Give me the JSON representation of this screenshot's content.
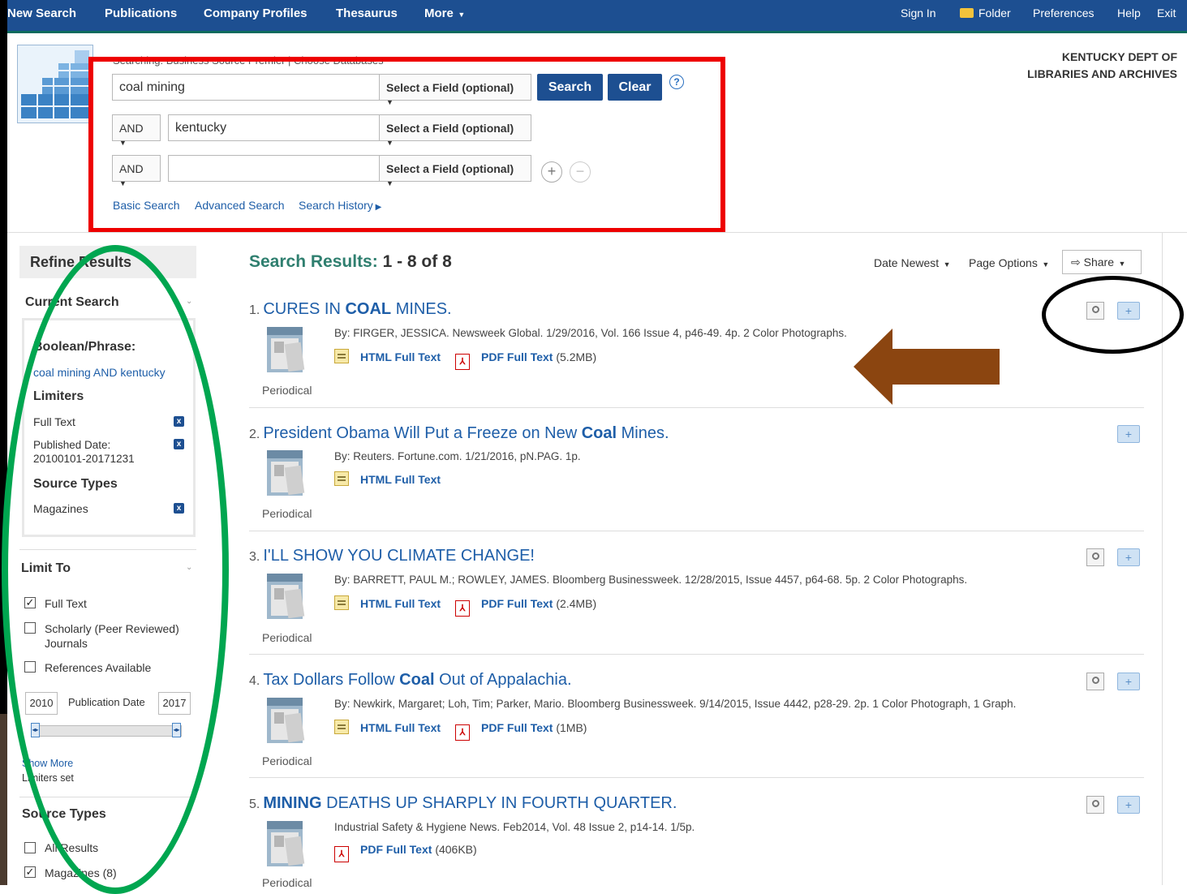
{
  "topnav": {
    "left": [
      "New Search",
      "Publications",
      "Company Profiles",
      "Thesaurus",
      "More"
    ],
    "right": {
      "sign_in": "Sign In",
      "folder": "Folder",
      "preferences": "Preferences",
      "help": "Help",
      "exit": "Exit"
    }
  },
  "header": {
    "org_line1": "KENTUCKY DEPT OF",
    "org_line2": "LIBRARIES AND ARCHIVES",
    "searching": "Searching: Business Source Premier | Choose Databases"
  },
  "search": {
    "row1_value": "coal mining",
    "row2_value": "kentucky",
    "row3_value": "",
    "field_label": "Select a Field (optional)",
    "bool": "AND",
    "search_btn": "Search",
    "clear_btn": "Clear",
    "help": "?",
    "links": {
      "basic": "Basic Search",
      "advanced": "Advanced Search",
      "history": "Search History"
    }
  },
  "sidebar": {
    "refine": "Refine Results",
    "current_search": "Current Search",
    "boolean_phrase": "Boolean/Phrase:",
    "query": "coal mining AND kentucky",
    "limiters": "Limiters",
    "full_text": "Full Text",
    "published_date_label": "Published Date:",
    "published_date_value": "20100101-20171231",
    "source_types": "Source Types",
    "magazines": "Magazines",
    "limit_to": "Limit To",
    "opt_full_text": "Full Text",
    "opt_scholarly_1": "Scholarly (Peer Reviewed)",
    "opt_scholarly_2": "Journals",
    "opt_references": "References Available",
    "year_from": "2010",
    "pub_date": "Publication Date",
    "year_to": "2017",
    "show_more": "Show More",
    "limiters_set": "Limiters set",
    "source_types2": "Source Types",
    "all_results": "All Results",
    "magazines_count": "Magazines (8)"
  },
  "results": {
    "title": "Search Results:",
    "range": "1 - 8 of 8",
    "sort": "Date Newest",
    "page_options": "Page Options",
    "share": "Share",
    "ptype": "Periodical",
    "html_ft": "HTML Full Text",
    "pdf_ft": "PDF Full Text",
    "items": [
      {
        "num": "1.",
        "t1": "CURES IN ",
        "t2": "COAL",
        "t3": " MINES.",
        "meta": "By: FIRGER, JESSICA. Newsweek Global. 1/29/2016, Vol. 166 Issue 4, p46-49. 4p. 2 Color Photographs.",
        "pdf_size": "(5.2MB)"
      },
      {
        "num": "2.",
        "t1": "President Obama Will Put a Freeze on New ",
        "t2": "Coal",
        "t3": " Mines.",
        "meta": "By: Reuters. Fortune.com. 1/21/2016, pN.PAG. 1p.",
        "pdf_size": ""
      },
      {
        "num": "3.",
        "t1": "I'LL SHOW YOU CLIMATE CHANGE!",
        "t2": "",
        "t3": "",
        "meta": "By: BARRETT, PAUL M.; ROWLEY, JAMES. Bloomberg Businessweek. 12/28/2015, Issue 4457, p64-68. 5p. 2 Color Photographs.",
        "pdf_size": "(2.4MB)"
      },
      {
        "num": "4.",
        "t1": "Tax Dollars Follow ",
        "t2": "Coal",
        "t3": " Out of Appalachia.",
        "meta": "By: Newkirk, Margaret; Loh, Tim; Parker, Mario. Bloomberg Businessweek. 9/14/2015, Issue 4442, p28-29. 2p. 1 Color Photograph, 1 Graph.",
        "pdf_size": "(1MB)"
      },
      {
        "num": "5.",
        "t1": "",
        "t2": "MINING",
        "t3": " DEATHS UP SHARPLY IN FOURTH QUARTER.",
        "meta": "Industrial Safety & Hygiene News. Feb2014, Vol. 48 Issue 2, p14-14. 1/5p.",
        "pdf_size": "(406KB)"
      }
    ]
  },
  "colors": {
    "nav": "#1d4f91",
    "highlight_red": "#ee0000",
    "highlight_green": "#00a650",
    "arrow": "#8b4510"
  }
}
